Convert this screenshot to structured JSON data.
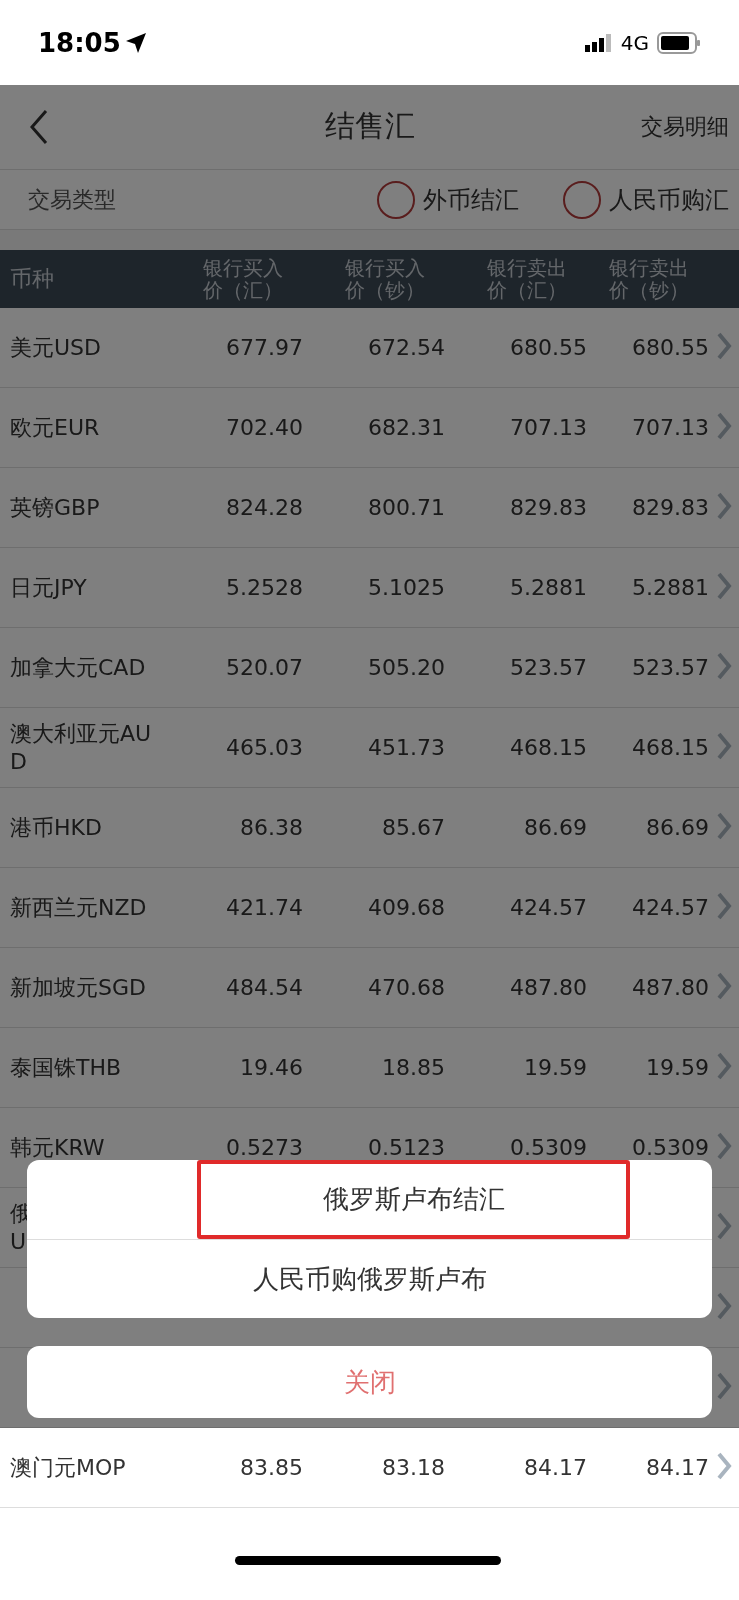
{
  "status_bar": {
    "time": "18:05",
    "network": "4G"
  },
  "nav": {
    "title": "结售汇",
    "action": "交易明细"
  },
  "trade_type": {
    "label": "交易类型",
    "options": [
      {
        "label": "外币结汇",
        "selected": false
      },
      {
        "label": "人民币购汇",
        "selected": false
      }
    ]
  },
  "table": {
    "columns": [
      "币种",
      "银行买入价（汇）",
      "银行买入价（钞）",
      "银行卖出价（汇）",
      "银行卖出价（钞）"
    ],
    "rows": [
      {
        "name": "美元USD",
        "values": [
          "677.97",
          "672.54",
          "680.55",
          "680.55"
        ]
      },
      {
        "name": "欧元EUR",
        "values": [
          "702.40",
          "682.31",
          "707.13",
          "707.13"
        ]
      },
      {
        "name": "英镑GBP",
        "values": [
          "824.28",
          "800.71",
          "829.83",
          "829.83"
        ]
      },
      {
        "name": "日元JPY",
        "values": [
          "5.2528",
          "5.1025",
          "5.2881",
          "5.2881"
        ]
      },
      {
        "name": "加拿大元CAD",
        "values": [
          "520.07",
          "505.20",
          "523.57",
          "523.57"
        ]
      },
      {
        "name": "澳大利亚元AUD",
        "values": [
          "465.03",
          "451.73",
          "468.15",
          "468.15"
        ]
      },
      {
        "name": "港币HKD",
        "values": [
          "86.38",
          "85.67",
          "86.69",
          "86.69"
        ]
      },
      {
        "name": "新西兰元NZD",
        "values": [
          "421.74",
          "409.68",
          "424.57",
          "424.57"
        ]
      },
      {
        "name": "新加坡元SGD",
        "values": [
          "484.54",
          "470.68",
          "487.80",
          "487.80"
        ]
      },
      {
        "name": "泰国铢THB",
        "values": [
          "19.46",
          "18.85",
          "19.59",
          "19.59"
        ]
      },
      {
        "name": "韩元KRW",
        "values": [
          "0.5273",
          "0.5123",
          "0.5309",
          "0.5309"
        ]
      },
      {
        "name": "俄\nU"
      },
      {
        "kind": "covered"
      },
      {
        "kind": "covered"
      },
      {
        "name": "澳门元MOP",
        "values": [
          "83.85",
          "83.18",
          "84.17",
          "84.17"
        ]
      }
    ]
  },
  "action_sheet": {
    "options": [
      {
        "label": "俄罗斯卢布结汇",
        "highlighted": true
      },
      {
        "label": "人民币购俄罗斯卢布",
        "highlighted": false
      }
    ],
    "close": "关闭"
  }
}
